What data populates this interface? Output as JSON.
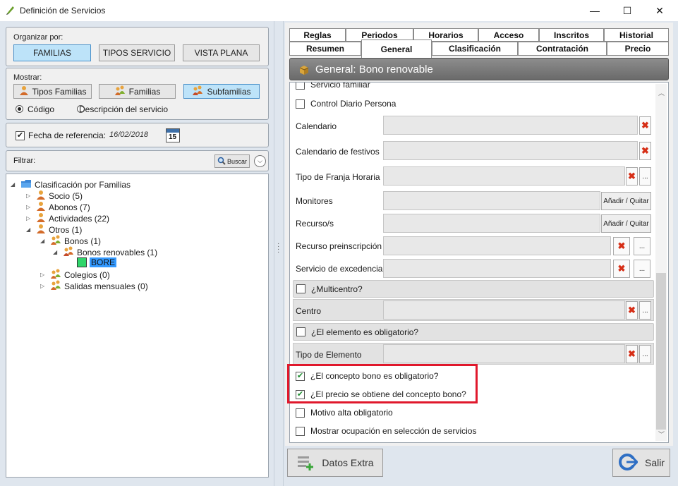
{
  "window": {
    "title": "Definición de Servicios",
    "minimize": "—",
    "maximize": "☐",
    "close": "✕"
  },
  "left": {
    "organizar_label": "Organizar por:",
    "organizar_buttons": [
      "FAMILIAS",
      "TIPOS SERVICIO",
      "VISTA PLANA"
    ],
    "mostrar_label": "Mostrar:",
    "mostrar_buttons": [
      "Tipos Familias",
      "Familias",
      "Subfamilias"
    ],
    "radio_codigo": "Código",
    "radio_descripcion": "Descripción del servicio",
    "fecha_label": "Fecha de referencia:",
    "fecha_value": "16/02/2018",
    "calendar_day": "15",
    "filtrar_label": "Filtrar:",
    "buscar_label": "Buscar",
    "tree": {
      "root": "Clasificación por Familias",
      "socio": "Socio (5)",
      "abonos": "Abonos (7)",
      "actividades": "Actividades (22)",
      "otros": "Otros (1)",
      "bonos": "Bonos (1)",
      "bonos_renovables": "Bonos renovables (1)",
      "bore": "BORE",
      "colegios": "Colegios (0)",
      "salidas": "Salidas mensuales (0)"
    }
  },
  "tabs": {
    "row1": [
      "Reglas",
      "Periodos",
      "Horarios",
      "Acceso",
      "Inscritos",
      "Historial"
    ],
    "row2": [
      "Resumen",
      "General",
      "Clasificación",
      "Contratación",
      "Precio"
    ]
  },
  "header_title": "General: Bono renovable",
  "form": {
    "servicio_familiar": "Servicio familiar",
    "control_diario": "Control Diario Persona",
    "calendario": "Calendario",
    "calendario_festivos": "Calendario de festivos",
    "franja": "Tipo de Franja Horaria",
    "monitores": "Monitores",
    "recursos": "Recurso/s",
    "anadir_quitar": "Añadir / Quitar",
    "recurso_pre": "Recurso preinscripción",
    "excedencia": "Servicio de excedencia",
    "multicentro": "¿Multicentro?",
    "centro": "Centro",
    "obligatorio": "¿El elemento es obligatorio?",
    "tipo_elemento": "Tipo de Elemento",
    "concepto_bono": "¿El concepto bono es obligatorio?",
    "precio_bono": "¿El precio se obtiene del concepto bono?",
    "motivo_alta": "Motivo alta obligatorio",
    "mostrar_ocupacion": "Mostrar ocupación en selección de servicios",
    "dots": "...",
    "x": "✖"
  },
  "bottom": {
    "datos_extra": "Datos Extra",
    "salir": "Salir"
  },
  "colors": {
    "highlight_box": "#e0182c",
    "selected_button": "#bde3f9",
    "delete_red": "#d62e16"
  }
}
